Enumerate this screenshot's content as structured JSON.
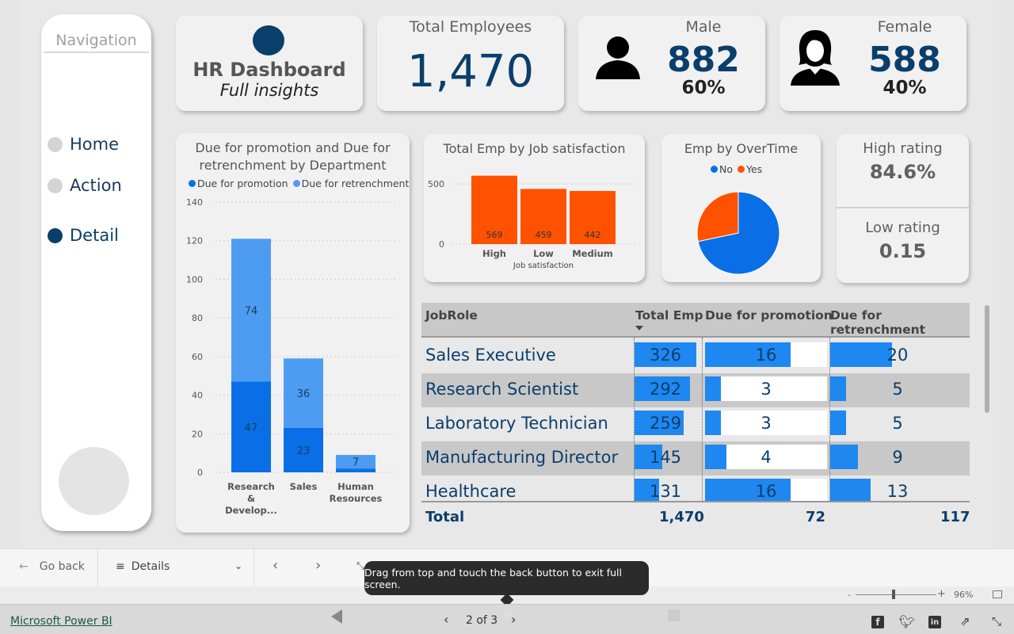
{
  "nav": {
    "title": "Navigation",
    "items": [
      {
        "label": "Home"
      },
      {
        "label": "Action"
      },
      {
        "label": "Detail"
      }
    ]
  },
  "header": {
    "title": "HR Dashboard",
    "subtitle": "Full insights"
  },
  "kpis": {
    "total_label": "Total Employees",
    "total_value": "1,470",
    "male_label": "Male",
    "male_value": "882",
    "male_pct": "60%",
    "female_label": "Female",
    "female_value": "588",
    "female_pct": "40%"
  },
  "ratings": {
    "high_label": "High rating",
    "high_value": "84.6%",
    "low_label": "Low rating",
    "low_value": "0.15"
  },
  "colors": {
    "dark_blue": "#0a3e6b",
    "blue": "#0a6fe6",
    "light_blue": "#4d9cf2",
    "orange": "#ff5200"
  },
  "chart_data": [
    {
      "type": "bar",
      "title": "Due for promotion and Due for retrenchment by Department",
      "stacked": true,
      "categories": [
        "Research & Develop...",
        "Sales",
        "Human Resources"
      ],
      "series": [
        {
          "name": "Due for promotion",
          "values": [
            47,
            23,
            2
          ]
        },
        {
          "name": "Due for retrenchment",
          "values": [
            74,
            36,
            7
          ]
        }
      ],
      "data_labels": [
        [
          "47",
          "23",
          ""
        ],
        [
          "74",
          "36",
          "7"
        ]
      ],
      "ylim": [
        0,
        140
      ],
      "yticks": [
        0,
        20,
        40,
        60,
        80,
        100,
        120,
        140
      ],
      "legend": "top"
    },
    {
      "type": "bar",
      "title": "Total Emp by Job satisfaction",
      "categories": [
        "High",
        "Low",
        "Medium"
      ],
      "values": [
        569,
        459,
        442
      ],
      "xlabel": "Job satisfaction",
      "yticks": [
        0,
        500
      ],
      "ylim": [
        0,
        600
      ]
    },
    {
      "type": "pie",
      "title": "Emp by OverTime",
      "categories": [
        "No",
        "Yes"
      ],
      "values": [
        1054,
        416
      ],
      "legend": "top"
    }
  ],
  "table": {
    "headers": [
      "JobRole",
      "Total Emp",
      "Due for promotion",
      "Due for retrenchment"
    ],
    "rows": [
      {
        "role": "Sales Executive",
        "total": 326,
        "promo": 16,
        "retr": 20
      },
      {
        "role": "Research Scientist",
        "total": 292,
        "promo": 3,
        "retr": 5
      },
      {
        "role": "Laboratory Technician",
        "total": 259,
        "promo": 3,
        "retr": 5
      },
      {
        "role": "Manufacturing Director",
        "total": 145,
        "promo": 4,
        "retr": 9
      },
      {
        "role": "Healthcare",
        "total": 131,
        "promo": 16,
        "retr": 13
      }
    ],
    "footer": {
      "label": "Total",
      "total": "1,470",
      "promo": "72",
      "retr": "117"
    }
  },
  "bottombar": {
    "go_back": "Go back",
    "page_select": "Details",
    "toast": "Drag from top and touch the back button to exit full screen.",
    "page_indicator": "2 of 3",
    "zoom": "96%"
  },
  "footer": {
    "link": "Microsoft Power BI"
  }
}
